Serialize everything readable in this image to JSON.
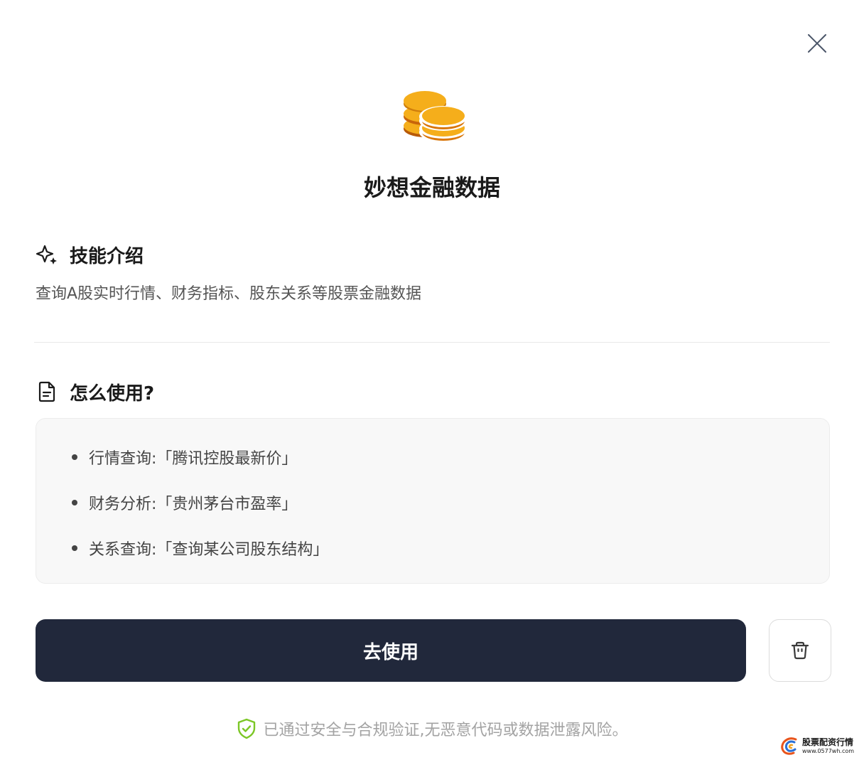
{
  "skill": {
    "title": "妙想金融数据"
  },
  "intro": {
    "heading": "技能介绍",
    "description": "查询A股实时行情、财务指标、股东关系等股票金融数据"
  },
  "usage": {
    "heading": "怎么使用?",
    "examples": [
      "行情查询:「腾讯控股最新价」",
      "财务分析:「贵州茅台市盈率」",
      "关系查询:「查询某公司股东结构」"
    ]
  },
  "actions": {
    "use_label": "去使用"
  },
  "security": {
    "note": "已通过安全与合规验证,无恶意代码或数据泄露风险。"
  },
  "watermark": {
    "text": "股票配资行情",
    "url": "www.0577wh.com"
  },
  "icons": {
    "close": "close-icon",
    "coins": "coins-icon",
    "sparkle": "sparkle-icon",
    "document": "document-icon",
    "trash": "trash-icon",
    "shield_check": "shield-check-icon"
  },
  "colors": {
    "primary_button": "#21283b",
    "coin_gold": "#f5ae1b",
    "coin_shadow": "#c8650a",
    "shield_green": "#7cc726",
    "muted_text": "#a3a3a3"
  }
}
